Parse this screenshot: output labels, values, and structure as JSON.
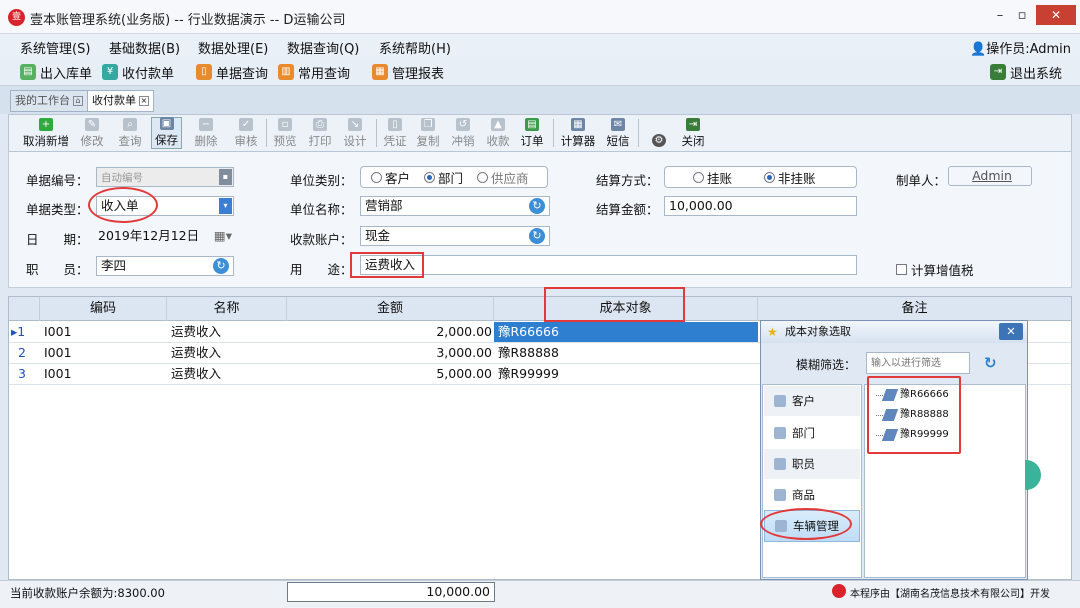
{
  "window": {
    "title": "壹本账管理系统(业务版) -- 行业数据演示 -- D运输公司",
    "logo_text": "壹",
    "controls": [
      "–",
      "▫",
      "✕"
    ]
  },
  "menu": {
    "items": [
      "系统管理(S)",
      "基础数据(B)",
      "数据处理(E)",
      "数据查询(Q)",
      "系统帮助(H)"
    ],
    "operator": "操作员:Admin"
  },
  "quickbar": {
    "items": [
      "出入库单",
      "收付款单",
      "单据查询",
      "常用查询",
      "管理报表"
    ],
    "exit": "退出系统"
  },
  "tabs": [
    {
      "label": "我的工作台"
    },
    {
      "label": "收付款单"
    }
  ],
  "toolbar": {
    "buttons": [
      "取消新增",
      "修改",
      "查询",
      "保存",
      "删除",
      "审核",
      "预览",
      "打印",
      "设计",
      "凭证",
      "复制",
      "冲销",
      "收款",
      "订单",
      "计算器",
      "短信",
      "关闭"
    ]
  },
  "form": {
    "doc_no_label": "单据编号：",
    "doc_no_value": "自动编号",
    "doc_type_label": "单据类型：",
    "doc_type_value": "收入单",
    "date_label": "日　　期：",
    "date_value": "2019年12月12日",
    "staff_label": "职　　员：",
    "staff_value": "李四",
    "unit_cat_label": "单位类别：",
    "unit_cat_options": [
      "客户",
      "部门",
      "供应商"
    ],
    "unit_cat_selected": "部门",
    "unit_name_label": "单位名称：",
    "unit_name_value": "营销部",
    "account_label": "收款账户：",
    "account_value": "现金",
    "purpose_label": "用　　途：",
    "purpose_value": "运费收入",
    "settle_label": "结算方式：",
    "settle_options": [
      "挂账",
      "非挂账"
    ],
    "settle_selected": "非挂账",
    "amount_label": "结算金额：",
    "amount_value": "10,000.00",
    "maker_label": "制单人：",
    "maker_value": "Admin",
    "vat_label": "计算增值税"
  },
  "grid": {
    "columns": [
      "编码",
      "名称",
      "金额",
      "成本对象",
      "备注"
    ],
    "rows": [
      {
        "num": "1",
        "code": "I001",
        "name": "运费收入",
        "amount": "2,000.00",
        "cost": "豫R66666"
      },
      {
        "num": "2",
        "code": "I001",
        "name": "运费收入",
        "amount": "3,000.00",
        "cost": "豫R88888"
      },
      {
        "num": "3",
        "code": "I001",
        "name": "运费收入",
        "amount": "5,000.00",
        "cost": "豫R99999"
      }
    ]
  },
  "popup": {
    "title": "成本对象选取",
    "filter_label": "模糊筛选：",
    "filter_placeholder": "输入以进行筛选",
    "categories": [
      "客户",
      "部门",
      "职员",
      "商品",
      "车辆管理"
    ],
    "nodes": [
      "豫R66666",
      "豫R88888",
      "豫R99999"
    ]
  },
  "status": {
    "balance": "当前收款账户余额为:8300.00",
    "total": "10,000.00",
    "brand": "本程序由【湖南名茂信息技术有限公司】开发"
  },
  "colors": {
    "accent": "#2f7fd0",
    "highlight_red": "#e23a3a",
    "selected_cell": "#2f7fd0"
  }
}
